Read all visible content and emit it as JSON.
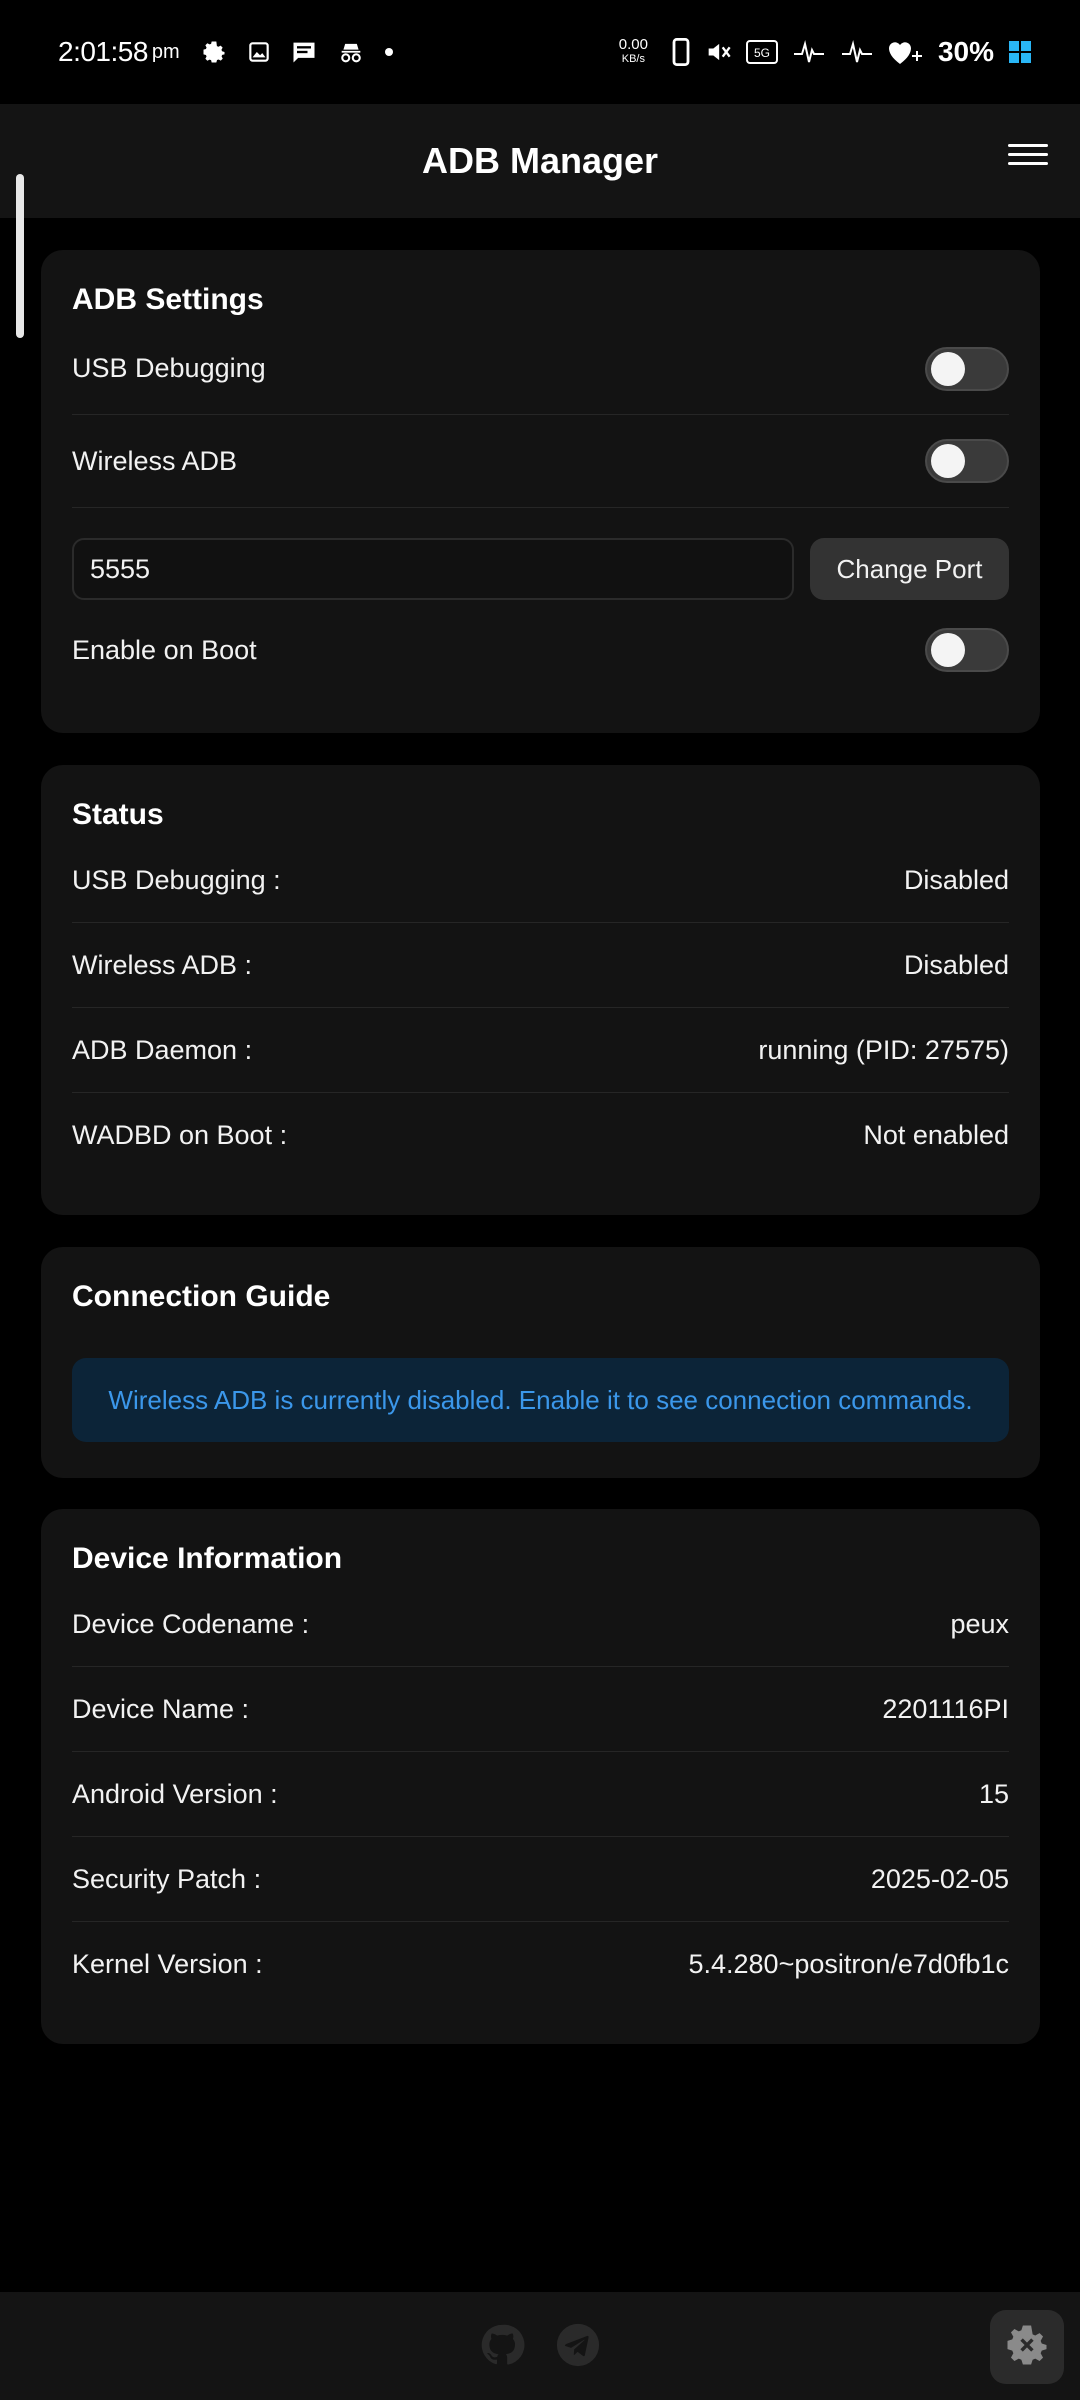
{
  "status_bar": {
    "time": "2:01:58",
    "ampm": "pm",
    "net_speed_value": "0.00",
    "net_speed_unit": "KB/s",
    "battery": "30%"
  },
  "app": {
    "title": "ADB Manager"
  },
  "adb_settings": {
    "title": "ADB Settings",
    "usb_debugging_label": "USB Debugging",
    "usb_debugging_on": false,
    "wireless_adb_label": "Wireless ADB",
    "wireless_adb_on": false,
    "port_value": "5555",
    "change_port_label": "Change Port",
    "enable_on_boot_label": "Enable on Boot",
    "enable_on_boot_on": false
  },
  "status": {
    "title": "Status",
    "rows": [
      {
        "label": "USB Debugging :",
        "value": "Disabled"
      },
      {
        "label": "Wireless ADB :",
        "value": "Disabled"
      },
      {
        "label": "ADB Daemon :",
        "value": "running (PID: 27575)"
      },
      {
        "label": "WADBD on Boot :",
        "value": "Not enabled"
      }
    ]
  },
  "connection_guide": {
    "title": "Connection Guide",
    "message": "Wireless ADB is currently disabled. Enable it to see connection commands."
  },
  "device_info": {
    "title": "Device Information",
    "rows": [
      {
        "label": "Device Codename :",
        "value": "peux"
      },
      {
        "label": "Device Name :",
        "value": "2201116PI"
      },
      {
        "label": "Android Version :",
        "value": "15"
      },
      {
        "label": "Security Patch :",
        "value": "2025-02-05"
      },
      {
        "label": "Kernel Version :",
        "value": "5.4.280~positron/e7d0fb1c"
      }
    ]
  },
  "colors": {
    "background": "#000000",
    "card": "#131313",
    "info_bg": "#0c2438",
    "info_text": "#3b97ea"
  },
  "icons": {
    "bottom_left": "github-icon",
    "bottom_right": "telegram-icon",
    "fab": "settings-gear-icon"
  }
}
